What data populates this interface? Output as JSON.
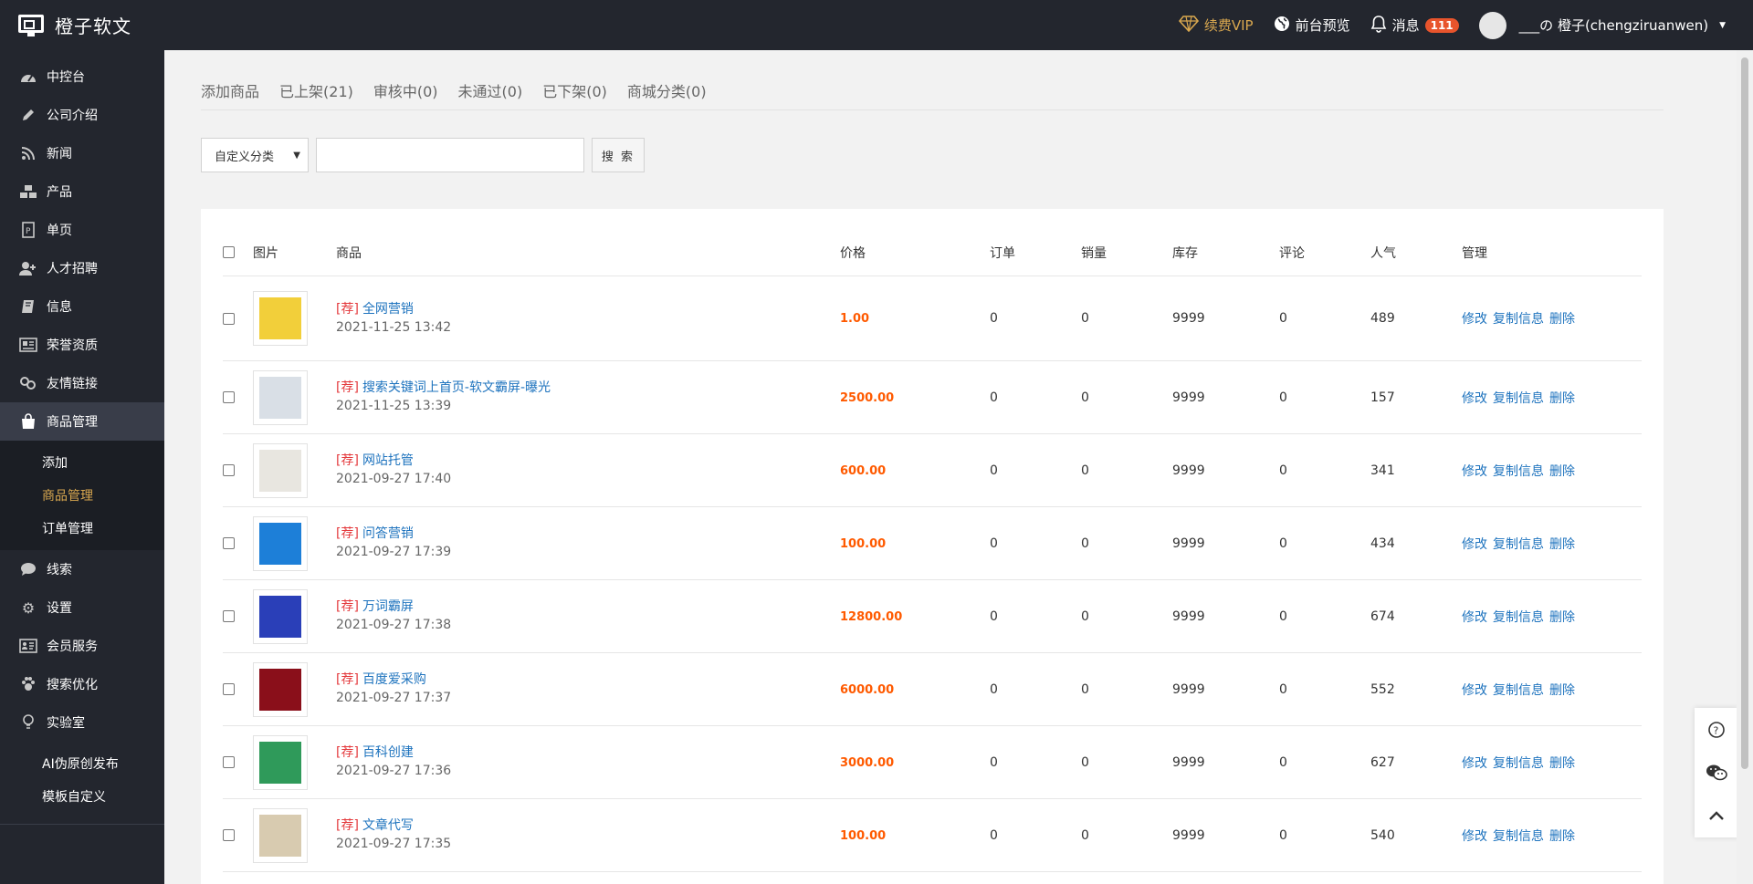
{
  "brand": {
    "name": "橙子软文"
  },
  "topbar": {
    "vip_label": "续费VIP",
    "preview_label": "前台预览",
    "messages_label": "消息",
    "messages_count": "111",
    "user_name": "___の 橙子(chengziruanwen)"
  },
  "sidebar": {
    "items": [
      {
        "label": "中控台",
        "icon": "dashboard-icon"
      },
      {
        "label": "公司介绍",
        "icon": "pencil-icon"
      },
      {
        "label": "新闻",
        "icon": "rss-icon"
      },
      {
        "label": "产品",
        "icon": "cubes-icon"
      },
      {
        "label": "单页",
        "icon": "page-icon"
      },
      {
        "label": "人才招聘",
        "icon": "add-user-icon"
      },
      {
        "label": "信息",
        "icon": "book-icon"
      },
      {
        "label": "荣誉资质",
        "icon": "newspaper-icon"
      },
      {
        "label": "友情链接",
        "icon": "link-icon"
      },
      {
        "label": "商品管理",
        "icon": "shopping-bag-icon"
      }
    ],
    "sub_items": [
      {
        "label": "添加"
      },
      {
        "label": "商品管理"
      },
      {
        "label": "订单管理"
      }
    ],
    "items2": [
      {
        "label": "线索",
        "icon": "comment-icon"
      },
      {
        "label": "设置",
        "icon": "gear-icon"
      },
      {
        "label": "会员服务",
        "icon": "id-card-icon"
      },
      {
        "label": "搜索优化",
        "icon": "paw-icon"
      },
      {
        "label": "实验室",
        "icon": "lightbulb-icon"
      }
    ],
    "sub_items2": [
      {
        "label": "AI伪原创发布"
      },
      {
        "label": "模板自定义"
      }
    ]
  },
  "tabs": [
    {
      "label": "添加商品"
    },
    {
      "label": "已上架(21)"
    },
    {
      "label": "审核中(0)"
    },
    {
      "label": "未通过(0)"
    },
    {
      "label": "已下架(0)"
    },
    {
      "label": "商城分类(0)"
    }
  ],
  "search": {
    "select_value": "自定义分类",
    "input_value": "",
    "button_label": "搜 索"
  },
  "table": {
    "headers": {
      "image": "图片",
      "product": "商品",
      "price": "价格",
      "order": "订单",
      "sales": "销量",
      "stock": "库存",
      "comment": "评论",
      "popularity": "人气",
      "manage": "管理"
    },
    "tag": "[荐]",
    "actions": {
      "edit": "修改",
      "copy": "复制信息",
      "delete": "删除"
    },
    "rows": [
      {
        "name": "全网营销",
        "date": "2021-11-25 13:42",
        "price": "1.00",
        "order": "0",
        "sales": "0",
        "stock": "9999",
        "comment": "0",
        "popularity": "489",
        "thumb_color": "#f2cf3a"
      },
      {
        "name": "搜索关键词上首页-软文霸屏-曝光",
        "date": "2021-11-25 13:39",
        "price": "2500.00",
        "order": "0",
        "sales": "0",
        "stock": "9999",
        "comment": "0",
        "popularity": "157",
        "thumb_color": "#d9dfe6"
      },
      {
        "name": "网站托管",
        "date": "2021-09-27 17:40",
        "price": "600.00",
        "order": "0",
        "sales": "0",
        "stock": "9999",
        "comment": "0",
        "popularity": "341",
        "thumb_color": "#e8e6e0"
      },
      {
        "name": "问答营销",
        "date": "2021-09-27 17:39",
        "price": "100.00",
        "order": "0",
        "sales": "0",
        "stock": "9999",
        "comment": "0",
        "popularity": "434",
        "thumb_color": "#1d7fd8"
      },
      {
        "name": "万词霸屏",
        "date": "2021-09-27 17:38",
        "price": "12800.00",
        "order": "0",
        "sales": "0",
        "stock": "9999",
        "comment": "0",
        "popularity": "674",
        "thumb_color": "#2a3fb8"
      },
      {
        "name": "百度爱采购",
        "date": "2021-09-27 17:37",
        "price": "6000.00",
        "order": "0",
        "sales": "0",
        "stock": "9999",
        "comment": "0",
        "popularity": "552",
        "thumb_color": "#8a0f1a"
      },
      {
        "name": "百科创建",
        "date": "2021-09-27 17:36",
        "price": "3000.00",
        "order": "0",
        "sales": "0",
        "stock": "9999",
        "comment": "0",
        "popularity": "627",
        "thumb_color": "#2f9a5a"
      },
      {
        "name": "文章代写",
        "date": "2021-09-27 17:35",
        "price": "100.00",
        "order": "0",
        "sales": "0",
        "stock": "9999",
        "comment": "0",
        "popularity": "540",
        "thumb_color": "#d8cbb0"
      }
    ]
  },
  "colors": {
    "topbar_bg": "#23262e",
    "accent_gold": "#d8a74f",
    "link_blue": "#1e73be",
    "price_orange": "#ff5a00",
    "tag_red": "#e4393c",
    "badge_red": "#e8542c"
  }
}
